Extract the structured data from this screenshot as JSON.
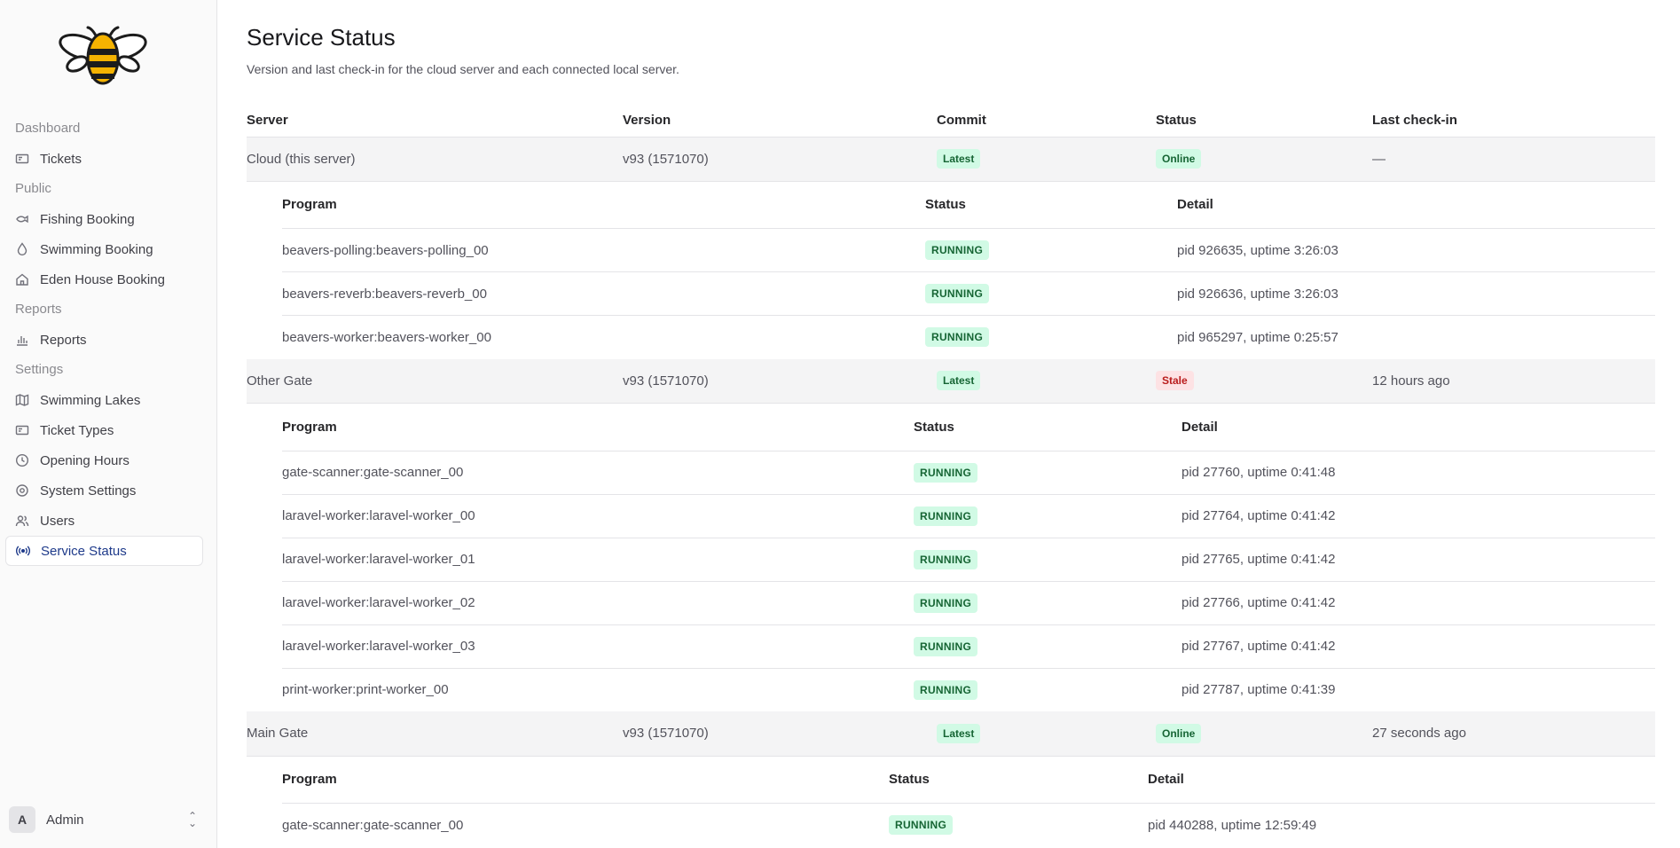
{
  "sidebar": {
    "logo_icon": "bee-logo-icon",
    "groups": [
      {
        "label": "Dashboard",
        "items": [
          {
            "label": "Tickets",
            "icon": "ticket-icon"
          }
        ]
      },
      {
        "label": "Public",
        "items": [
          {
            "label": "Fishing Booking",
            "icon": "fish-icon"
          },
          {
            "label": "Swimming Booking",
            "icon": "water-drop-icon"
          },
          {
            "label": "Eden House Booking",
            "icon": "house-icon"
          }
        ]
      },
      {
        "label": "Reports",
        "items": [
          {
            "label": "Reports",
            "icon": "bar-chart-icon"
          }
        ]
      },
      {
        "label": "Settings",
        "items": [
          {
            "label": "Swimming Lakes",
            "icon": "map-icon"
          },
          {
            "label": "Ticket Types",
            "icon": "ticket-icon"
          },
          {
            "label": "Opening Hours",
            "icon": "clock-icon"
          },
          {
            "label": "System Settings",
            "icon": "gear-icon"
          },
          {
            "label": "Users",
            "icon": "users-icon"
          },
          {
            "label": "Service Status",
            "icon": "broadcast-icon",
            "active": true
          }
        ]
      }
    ],
    "user": {
      "initial": "A",
      "name": "Admin"
    }
  },
  "page": {
    "title": "Service Status",
    "subtitle": "Version and last check-in for the cloud server and each connected local server."
  },
  "table": {
    "headers": {
      "server": "Server",
      "version": "Version",
      "commit": "Commit",
      "status": "Status",
      "last_checkin": "Last check-in"
    },
    "program_headers": {
      "program": "Program",
      "status": "Status",
      "detail": "Detail"
    },
    "servers": [
      {
        "name": "Cloud (this server)",
        "version": "v93 (1571070)",
        "commit": "Latest",
        "status": "Online",
        "status_color": "#d1fae5",
        "last_checkin": "—",
        "programs": [
          {
            "program": "beavers-polling:beavers-polling_00",
            "status": "RUNNING",
            "detail": "pid 926635, uptime 3:26:03"
          },
          {
            "program": "beavers-reverb:beavers-reverb_00",
            "status": "RUNNING",
            "detail": "pid 926636, uptime 3:26:03"
          },
          {
            "program": "beavers-worker:beavers-worker_00",
            "status": "RUNNING",
            "detail": "pid 965297, uptime 0:25:57"
          }
        ]
      },
      {
        "name": "Other Gate",
        "version": "v93 (1571070)",
        "commit": "Latest",
        "status": "Stale",
        "status_color": "#fde2e4",
        "last_checkin": "12 hours ago",
        "programs": [
          {
            "program": "gate-scanner:gate-scanner_00",
            "status": "RUNNING",
            "detail": "pid 27760, uptime 0:41:48"
          },
          {
            "program": "laravel-worker:laravel-worker_00",
            "status": "RUNNING",
            "detail": "pid 27764, uptime 0:41:42"
          },
          {
            "program": "laravel-worker:laravel-worker_01",
            "status": "RUNNING",
            "detail": "pid 27765, uptime 0:41:42"
          },
          {
            "program": "laravel-worker:laravel-worker_02",
            "status": "RUNNING",
            "detail": "pid 27766, uptime 0:41:42"
          },
          {
            "program": "laravel-worker:laravel-worker_03",
            "status": "RUNNING",
            "detail": "pid 27767, uptime 0:41:42"
          },
          {
            "program": "print-worker:print-worker_00",
            "status": "RUNNING",
            "detail": "pid 27787, uptime 0:41:39"
          }
        ]
      },
      {
        "name": "Main Gate",
        "version": "v93 (1571070)",
        "commit": "Latest",
        "status": "Online",
        "status_color": "#d1fae5",
        "last_checkin": "27 seconds ago",
        "programs": [
          {
            "program": "gate-scanner:gate-scanner_00",
            "status": "RUNNING",
            "detail": "pid 440288, uptime 12:59:49"
          }
        ]
      }
    ]
  }
}
